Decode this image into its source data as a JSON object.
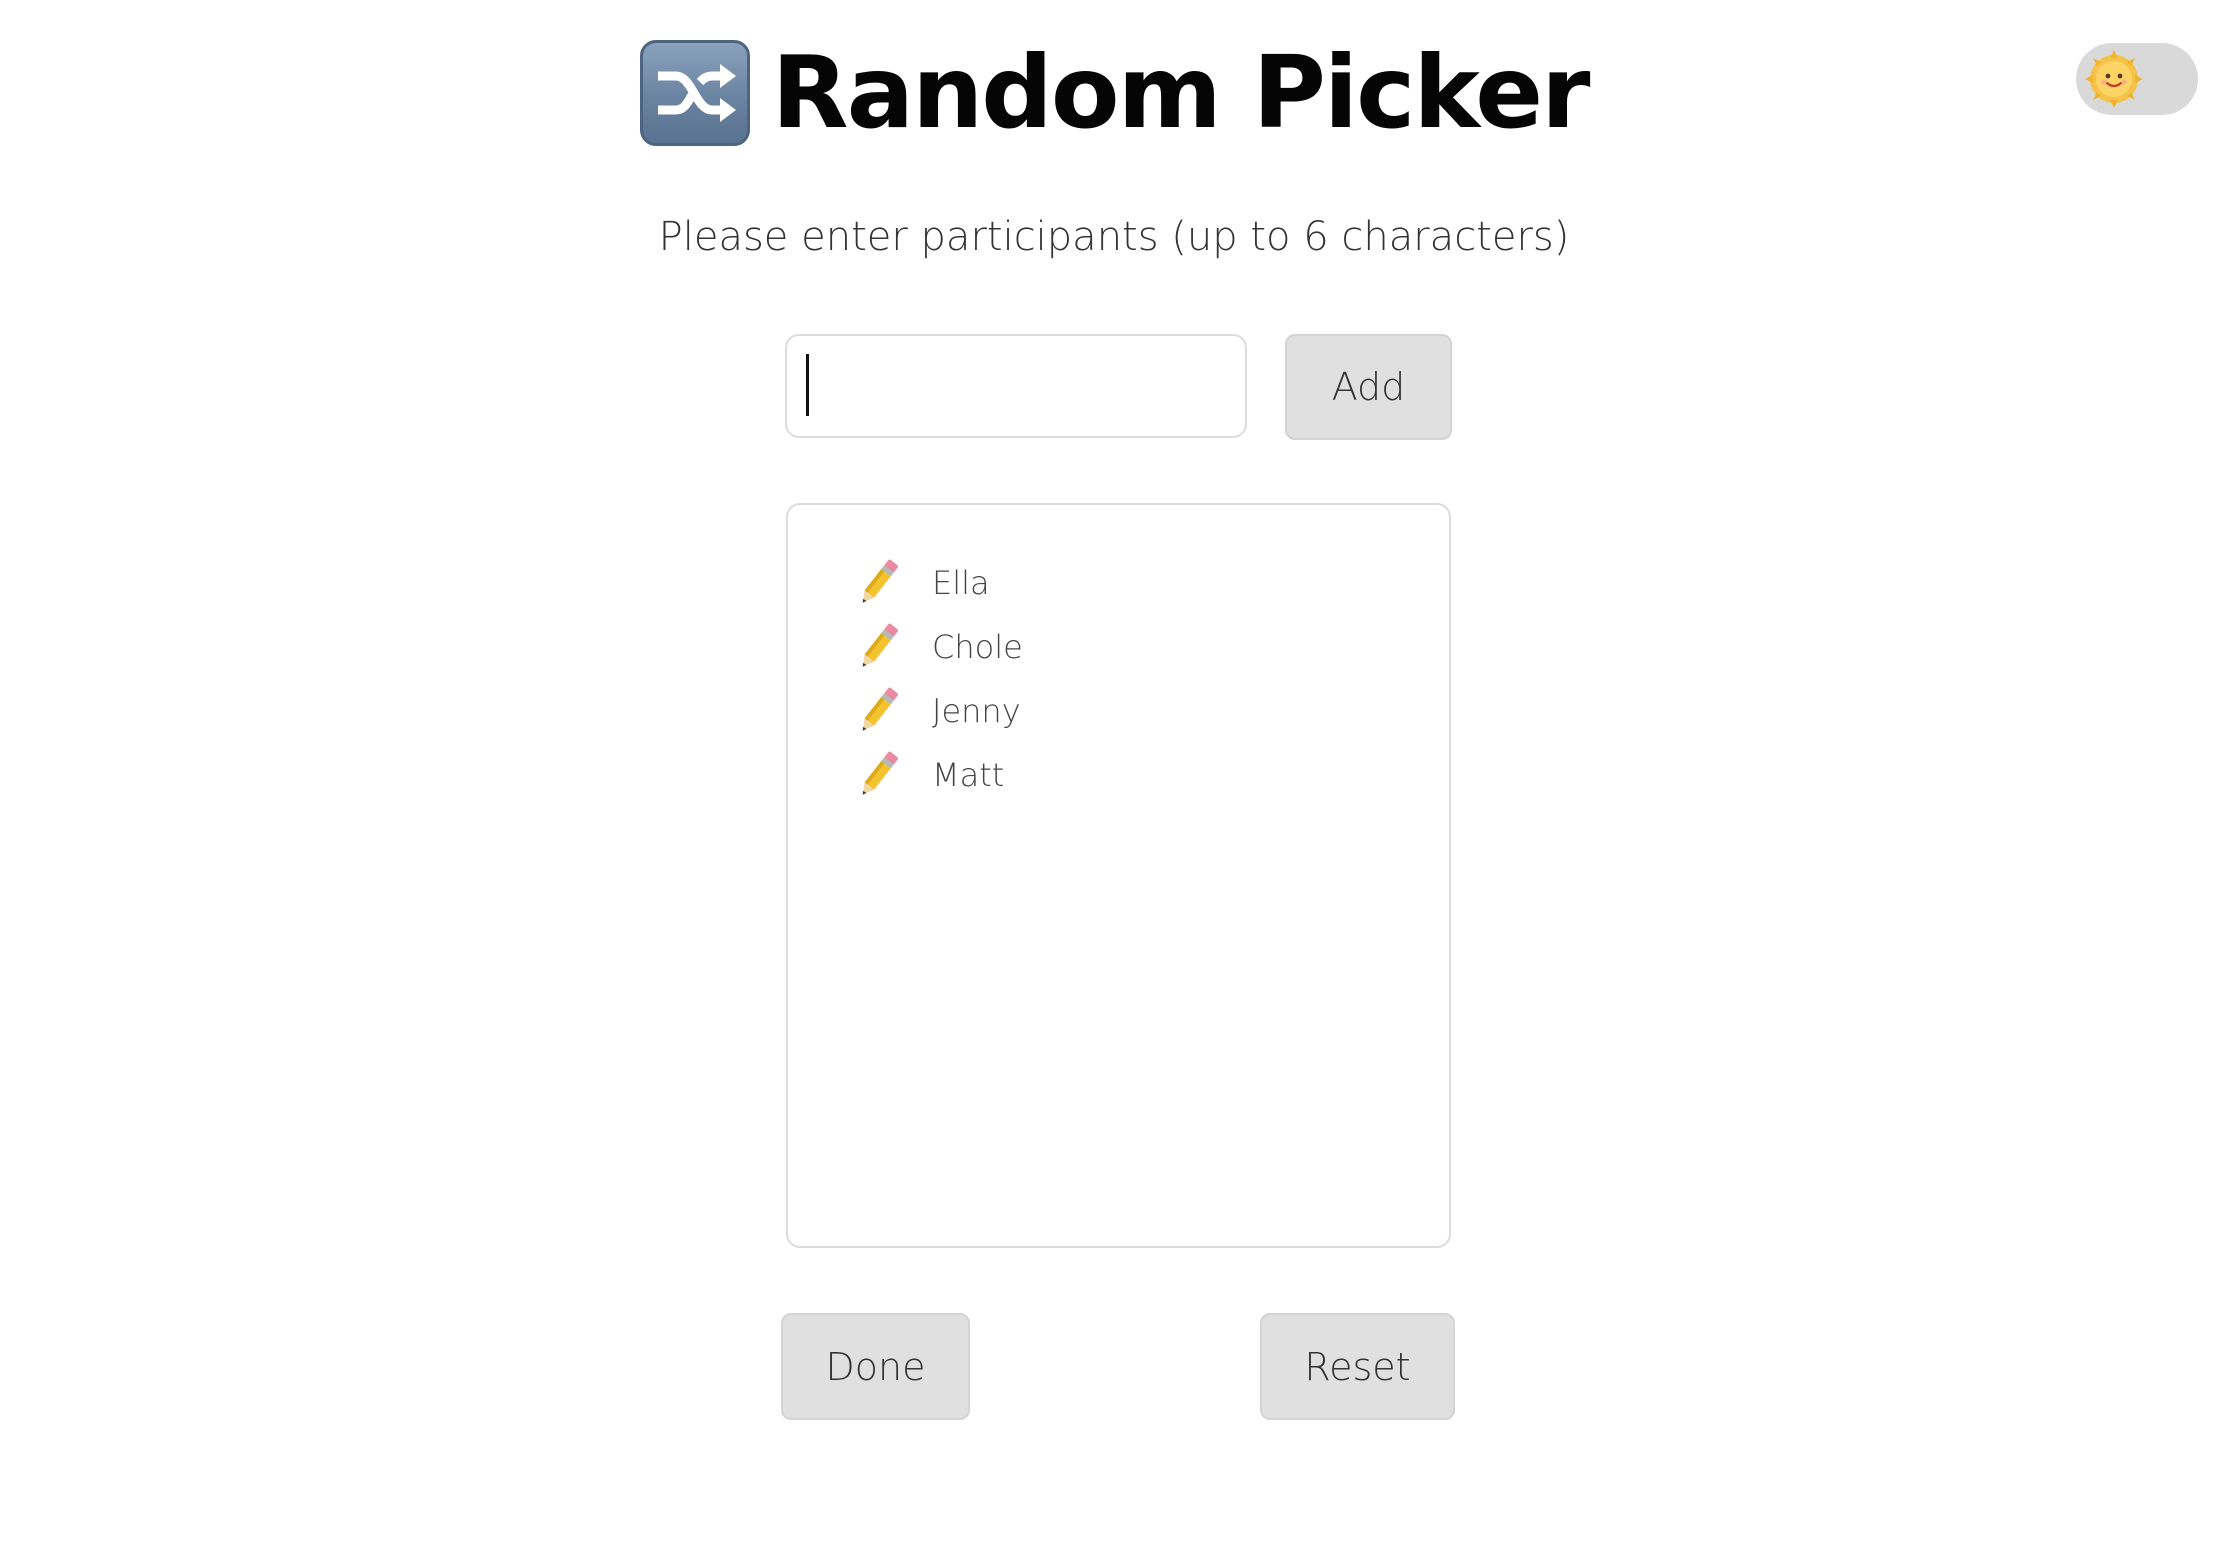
{
  "header": {
    "title": "Random Picker",
    "title_icon": "shuffle-icon"
  },
  "theme_toggle": {
    "icon": "sun-face-icon",
    "state": "light"
  },
  "subtitle": "Please enter participants (up to 6 characters)",
  "input": {
    "value": "",
    "placeholder": ""
  },
  "buttons": {
    "add_label": "Add",
    "done_label": "Done",
    "reset_label": "Reset"
  },
  "participants": [
    {
      "name": "Ella",
      "icon": "pencil-icon"
    },
    {
      "name": "Chole",
      "icon": "pencil-icon"
    },
    {
      "name": "Jenny",
      "icon": "pencil-icon"
    },
    {
      "name": "Matt",
      "icon": "pencil-icon"
    }
  ],
  "colors": {
    "button_bg": "#e0e0e0",
    "border": "#dcdcdc",
    "toggle_bg": "#d9d9d9",
    "title_icon_bg": "#6a83a0"
  }
}
